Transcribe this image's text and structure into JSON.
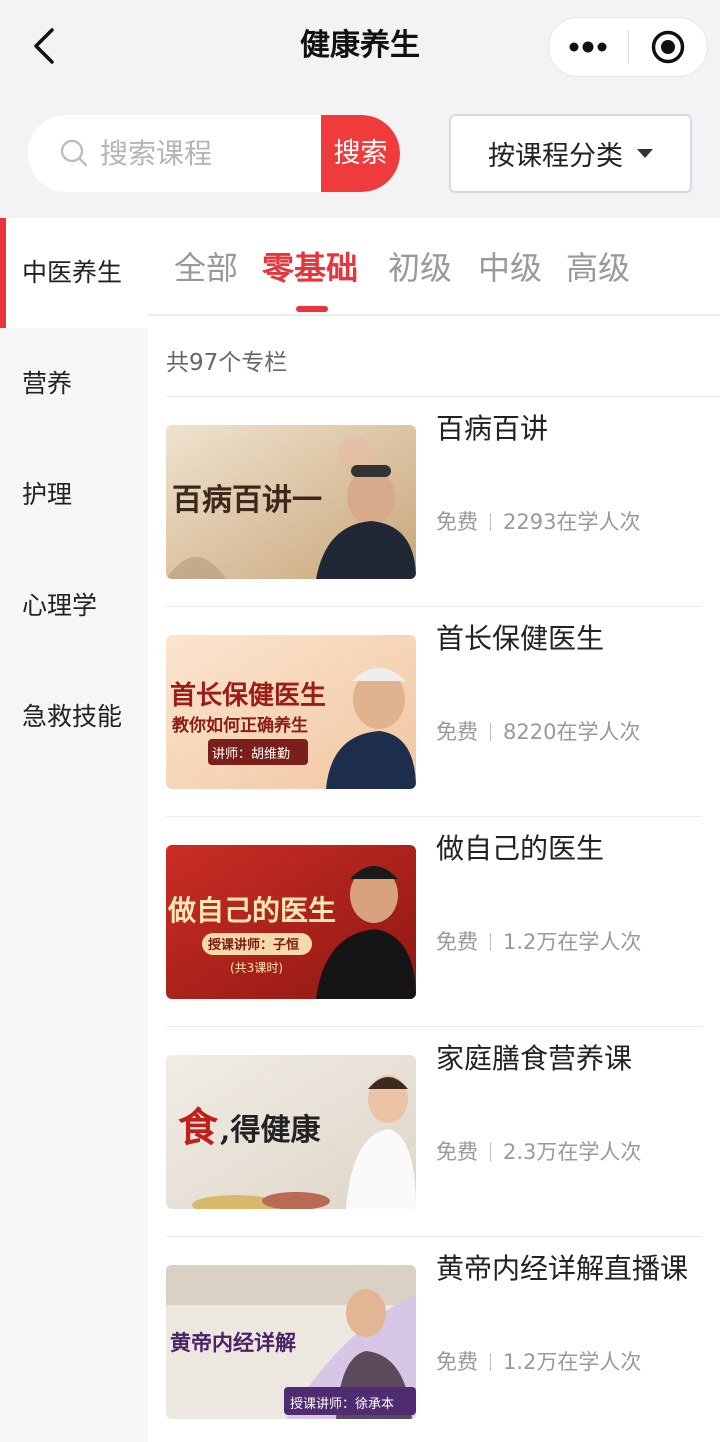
{
  "nav": {
    "title": "健康养生"
  },
  "search": {
    "placeholder": "搜索课程",
    "button_label": "搜索"
  },
  "category_select": {
    "label": "按课程分类"
  },
  "sidebar": {
    "items": [
      {
        "label": "中医养生",
        "active": true
      },
      {
        "label": "营养",
        "active": false
      },
      {
        "label": "护理",
        "active": false
      },
      {
        "label": "心理学",
        "active": false
      },
      {
        "label": "急救技能",
        "active": false
      }
    ]
  },
  "tabs": [
    {
      "label": "全部",
      "active": false
    },
    {
      "label": "零基础",
      "active": true
    },
    {
      "label": "初级",
      "active": false
    },
    {
      "label": "中级",
      "active": false
    },
    {
      "label": "高级",
      "active": false
    }
  ],
  "list": {
    "count_text": "共97个专栏",
    "courses": [
      {
        "title": "百病百讲",
        "price": "免费",
        "learners": "2293在学人次",
        "thumb": {
          "headline": "百病百讲一",
          "subline": "",
          "teacher": ""
        }
      },
      {
        "title": "首长保健医生",
        "price": "免费",
        "learners": "8220在学人次",
        "thumb": {
          "headline": "首长保健医生",
          "subline": "教你如何正确养生",
          "teacher": "讲师：胡维勤"
        }
      },
      {
        "title": "做自己的医生",
        "price": "免费",
        "learners": "1.2万在学人次",
        "thumb": {
          "headline": "做自己的医生",
          "subline": "授课讲师：子恒",
          "teacher": "(共3课时)"
        }
      },
      {
        "title": "家庭膳食营养课",
        "price": "免费",
        "learners": "2.3万在学人次",
        "thumb": {
          "headline_accent": "食",
          "headline": ",得健康",
          "subline": "",
          "teacher": ""
        }
      },
      {
        "title": "黄帝内经详解直播课",
        "price": "免费",
        "learners": "1.2万在学人次",
        "thumb": {
          "headline": "黄帝内经详解",
          "subline": "",
          "teacher": "授课讲师：徐承本"
        }
      }
    ]
  },
  "colors": {
    "accent": "#e8343a",
    "search_button": "#ef3b3b",
    "top_background": "#f3f3f5",
    "sidebar_background": "#f6f6f8"
  },
  "icons": {
    "back": "chevron-left-icon",
    "more": "more-dots-icon",
    "close": "target-circle-icon",
    "search": "magnifier-icon",
    "dropdown": "caret-down-icon"
  }
}
